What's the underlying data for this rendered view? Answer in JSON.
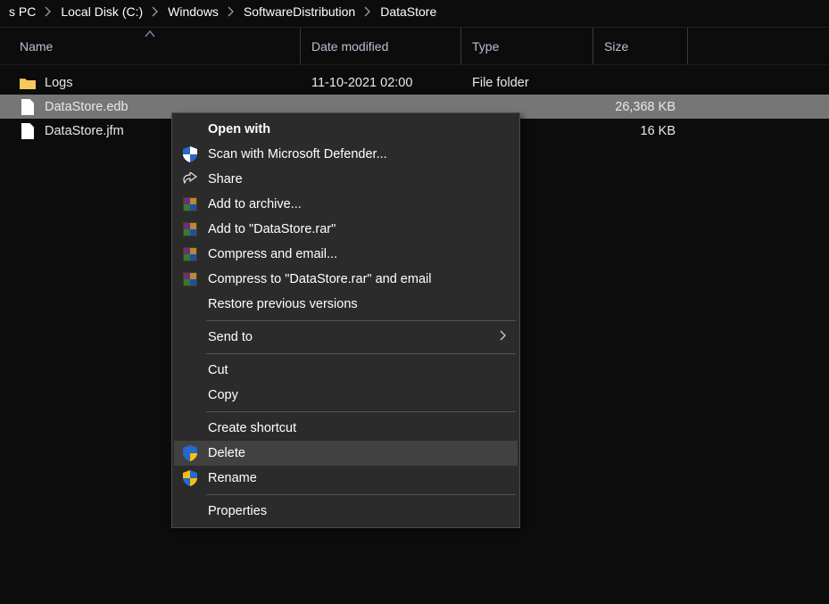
{
  "breadcrumbs": [
    "s PC",
    "Local Disk (C:)",
    "Windows",
    "SoftwareDistribution",
    "DataStore"
  ],
  "columns": {
    "name": "Name",
    "date": "Date modified",
    "type": "Type",
    "size": "Size"
  },
  "files": [
    {
      "icon": "folder",
      "name": "Logs",
      "date": "11-10-2021 02:00",
      "type": "File folder",
      "size": ""
    },
    {
      "icon": "file",
      "name": "DataStore.edb",
      "date": "",
      "type": "",
      "size": "26,368 KB",
      "selected": true
    },
    {
      "icon": "file",
      "name": "DataStore.jfm",
      "date": "",
      "type": "",
      "size": "16 KB"
    }
  ],
  "context_menu": {
    "open_with": "Open with",
    "scan_defender": "Scan with Microsoft Defender...",
    "share": "Share",
    "add_archive": "Add to archive...",
    "add_rar": "Add to \"DataStore.rar\"",
    "compress_email": "Compress and email...",
    "compress_rar_email": "Compress to \"DataStore.rar\" and email",
    "restore_versions": "Restore previous versions",
    "send_to": "Send to",
    "cut": "Cut",
    "copy": "Copy",
    "create_shortcut": "Create shortcut",
    "delete": "Delete",
    "rename": "Rename",
    "properties": "Properties"
  }
}
